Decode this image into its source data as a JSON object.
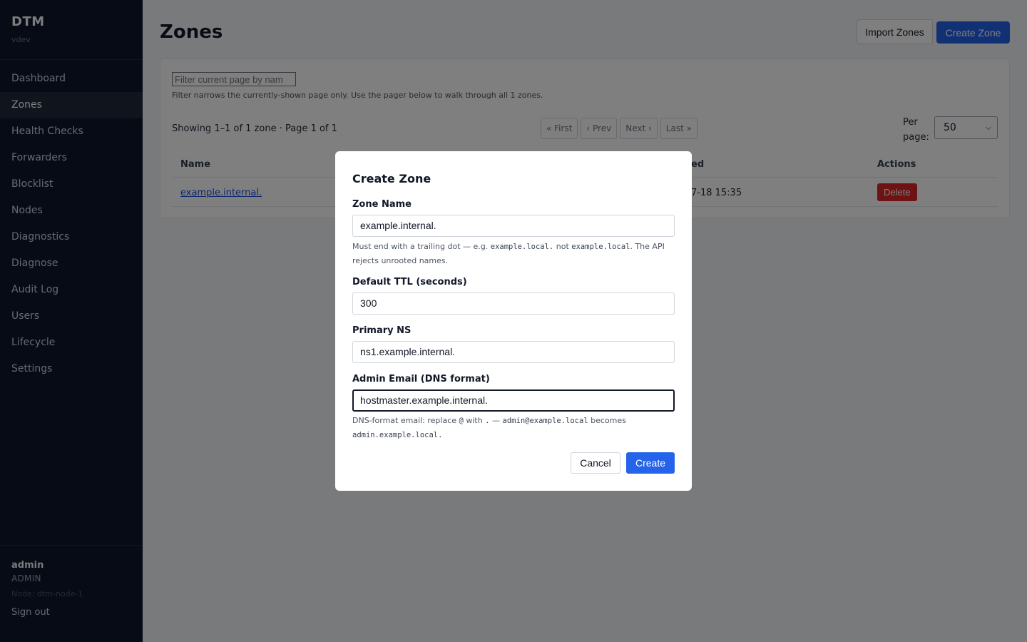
{
  "sidebar": {
    "brand": "DTM",
    "version": "vdev",
    "items": [
      {
        "label": "Dashboard"
      },
      {
        "label": "Zones"
      },
      {
        "label": "Health Checks"
      },
      {
        "label": "Forwarders"
      },
      {
        "label": "Blocklist"
      },
      {
        "label": "Nodes"
      },
      {
        "label": "Diagnostics"
      },
      {
        "label": "Diagnose"
      },
      {
        "label": "Audit Log"
      },
      {
        "label": "Users"
      },
      {
        "label": "Lifecycle"
      },
      {
        "label": "Settings"
      }
    ],
    "active_item": "Zones",
    "user": {
      "name": "admin",
      "role": "ADMIN",
      "node": "Node: dtm-node-1",
      "signout": "Sign out"
    }
  },
  "header": {
    "title": "Zones",
    "import_label": "Import Zones",
    "create_label": "Create Zone"
  },
  "list": {
    "filter_placeholder": "Filter current page by nam",
    "filter_hint": "Filter narrows the currently-shown page only. Use the pager below to walk through all 1 zones.",
    "showing": "Showing 1–1 of 1 zone · Page 1 of 1",
    "pager": {
      "first": "« First",
      "prev": "‹ Prev",
      "next": "Next ›",
      "last": "Last »"
    },
    "per_page_label": "Per page:",
    "per_page_value": "50",
    "columns": {
      "name": "Name",
      "created": "ed",
      "actions": "Actions"
    },
    "rows": [
      {
        "name": "example.internal.",
        "created": "7-18 15:35",
        "action": "Delete"
      }
    ]
  },
  "modal": {
    "title": "Create Zone",
    "zone_name": {
      "label": "Zone Name",
      "value": "example.internal.",
      "help_prefix": "Must end with a trailing dot — e.g. ",
      "help_code1": "example.local.",
      "help_mid": " not ",
      "help_code2": "example.local",
      "help_suffix": ". The API rejects unrooted names."
    },
    "ttl": {
      "label": "Default TTL (seconds)",
      "value": "300"
    },
    "primary_ns": {
      "label": "Primary NS",
      "value": "ns1.example.internal."
    },
    "admin_email": {
      "label": "Admin Email (DNS format)",
      "value": "hostmaster.example.internal.",
      "help_prefix": "DNS-format email: replace ",
      "help_at": "@",
      "help_with": " with ",
      "help_dot": ".",
      "help_dash": " — ",
      "help_code1": "admin@example.local",
      "help_becomes": " becomes ",
      "help_code2": "admin.example.local."
    },
    "cancel_label": "Cancel",
    "create_label": "Create"
  },
  "colors": {
    "sidebar_bg": "#0f172a",
    "primary": "#2563eb",
    "danger": "#dc2626"
  }
}
